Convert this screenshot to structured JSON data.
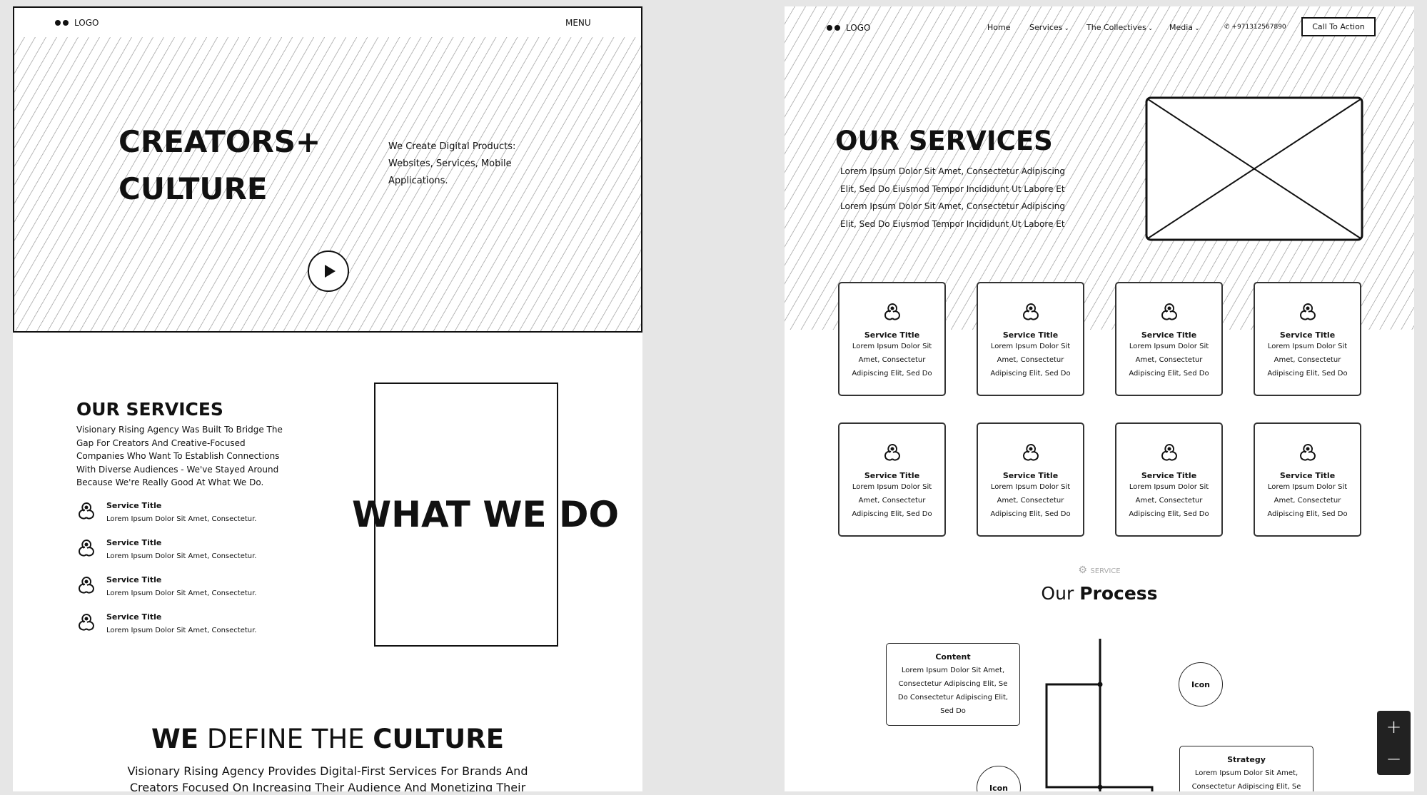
{
  "left": {
    "logo": "LOGO",
    "menu": "MENU",
    "hero_line1": "CREATORS+",
    "hero_line2": "CULTURE",
    "hero_text": [
      "We Create Digital Products:",
      "Websites, Services, Mobile",
      "Applications."
    ],
    "services_heading": "OUR SERVICES",
    "services_paragraph": [
      "Visionary Rising Agency Was Built To Bridge The",
      "Gap For Creators And Creative-Focused",
      "Companies Who Want To Establish Connections",
      "With Diverse Audiences - We've Stayed Around",
      "Because We're Really Good At What We Do."
    ],
    "service_items": [
      {
        "title": "Service Title",
        "desc": "Lorem Ipsum Dolor Sit Amet, Consectetur."
      },
      {
        "title": "Service Title",
        "desc": "Lorem Ipsum Dolor Sit Amet, Consectetur."
      },
      {
        "title": "Service Title",
        "desc": "Lorem Ipsum Dolor Sit Amet, Consectetur."
      },
      {
        "title": "Service Title",
        "desc": "Lorem Ipsum Dolor Sit Amet, Consectetur."
      }
    ],
    "what_we_do": "WHAT WE DO",
    "culture_bold1": "WE",
    "culture_mid": "DEFINE THE",
    "culture_bold2": "CULTURE",
    "culture_paragraph": [
      "Visionary Rising Agency Provides Digital-First Services For Brands And",
      "Creators Focused On Increasing Their Audience And Monetizing Their"
    ]
  },
  "right": {
    "logo": "LOGO",
    "nav": {
      "home": "Home",
      "services": "Services",
      "collectives": "The Collectives",
      "media": "Media",
      "phone": "+971312567890",
      "cta": "Call To Action"
    },
    "heading": "OUR SERVICES",
    "intro": [
      "Lorem Ipsum Dolor Sit Amet, Consectetur Adipiscing",
      "Elit, Sed Do Eiusmod Tempor Incididunt Ut Labore Et",
      "Lorem Ipsum Dolor Sit Amet, Consectetur Adipiscing",
      "Elit, Sed Do Eiusmod Tempor Incididunt Ut Labore Et"
    ],
    "cards": [
      {
        "title": "Service Title",
        "lines": [
          "Lorem Ipsum Dolor Sit",
          "Amet, Consectetur",
          "Adipiscing Elit, Sed Do"
        ]
      },
      {
        "title": "Service Title",
        "lines": [
          "Lorem Ipsum Dolor Sit",
          "Amet, Consectetur",
          "Adipiscing Elit, Sed Do"
        ]
      },
      {
        "title": "Service Title",
        "lines": [
          "Lorem Ipsum Dolor Sit",
          "Amet, Consectetur",
          "Adipiscing Elit, Sed Do"
        ]
      },
      {
        "title": "Service Title",
        "lines": [
          "Lorem Ipsum Dolor Sit",
          "Amet, Consectetur",
          "Adipiscing Elit, Sed Do"
        ]
      },
      {
        "title": "Service Title",
        "lines": [
          "Lorem Ipsum Dolor Sit",
          "Amet, Consectetur",
          "Adipiscing Elit, Sed Do"
        ]
      },
      {
        "title": "Service Title",
        "lines": [
          "Lorem Ipsum Dolor Sit",
          "Amet, Consectetur",
          "Adipiscing Elit, Sed Do"
        ]
      },
      {
        "title": "Service Title",
        "lines": [
          "Lorem Ipsum Dolor Sit",
          "Amet, Consectetur",
          "Adipiscing Elit, Sed Do"
        ]
      },
      {
        "title": "Service Title",
        "lines": [
          "Lorem Ipsum Dolor Sit",
          "Amet, Consectetur",
          "Adipiscing Elit, Sed Do"
        ]
      }
    ],
    "process_label": "SERVICE",
    "process_light": "Our",
    "process_bold": "Process",
    "content_box": {
      "title": "Content",
      "lines": [
        "Lorem Ipsum Dolor Sit Amet,",
        "Consectetur Adipiscing Elit, Se",
        "Do Consectetur Adipiscing Elit,",
        "Sed Do"
      ]
    },
    "strategy_box": {
      "title": "Strategy",
      "lines": [
        "Lorem Ipsum Dolor Sit Amet,",
        "Consectetur Adipiscing Elit, Se"
      ]
    },
    "icon_label_1": "Icon",
    "icon_label_2": "Icon"
  },
  "zoom_controls": {
    "plus": "+",
    "minus": "−"
  }
}
